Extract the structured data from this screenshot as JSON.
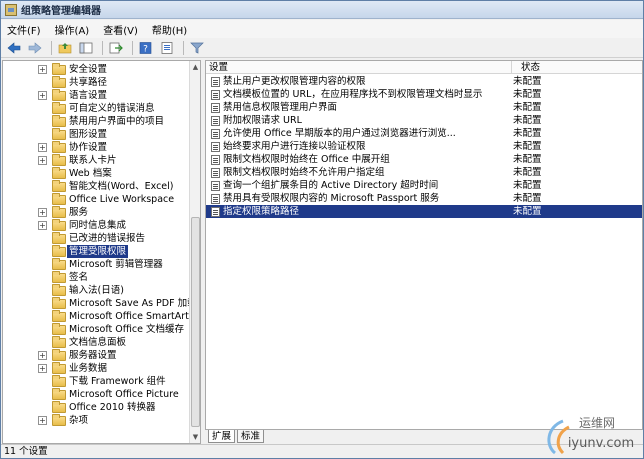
{
  "window": {
    "title": "组策略管理编辑器"
  },
  "menu": [
    "文件(F)",
    "操作(A)",
    "查看(V)",
    "帮助(H)"
  ],
  "toolbar": {
    "icons": [
      "back-arrow-icon",
      "forward-arrow-icon",
      "up-folder-icon",
      "show-hide-tree-icon",
      "export-list-icon",
      "help-icon",
      "properties-icon",
      "filter-icon"
    ]
  },
  "tree": [
    {
      "label": "安全设置",
      "expander": true
    },
    {
      "label": "共享路径",
      "expander": false
    },
    {
      "label": "语言设置",
      "expander": true
    },
    {
      "label": "可自定义的错误消息",
      "expander": false
    },
    {
      "label": "禁用用户界面中的项目",
      "expander": false
    },
    {
      "label": "图形设置",
      "expander": false
    },
    {
      "label": "协作设置",
      "expander": true
    },
    {
      "label": "联系人卡片",
      "expander": true
    },
    {
      "label": "Web 档案",
      "expander": false
    },
    {
      "label": "智能文档(Word、Excel)",
      "expander": false
    },
    {
      "label": "Office Live Workspace",
      "expander": false
    },
    {
      "label": "服务",
      "expander": true
    },
    {
      "label": "同时信息集成",
      "expander": true
    },
    {
      "label": "已改进的错误报告",
      "expander": false
    },
    {
      "label": "管理受限权限",
      "expander": false,
      "selected": true
    },
    {
      "label": "Microsoft 剪辑管理器",
      "expander": false
    },
    {
      "label": "签名",
      "expander": false
    },
    {
      "label": "输入法(日语)",
      "expander": false
    },
    {
      "label": "Microsoft Save As PDF 加载",
      "expander": false
    },
    {
      "label": "Microsoft Office SmartArt",
      "expander": false
    },
    {
      "label": "Microsoft Office 文档缓存",
      "expander": false
    },
    {
      "label": "文档信息面板",
      "expander": false
    },
    {
      "label": "服务器设置",
      "expander": true
    },
    {
      "label": "业务数据",
      "expander": true
    },
    {
      "label": "下载 Framework 组件",
      "expander": false
    },
    {
      "label": "Microsoft Office Picture",
      "expander": false
    },
    {
      "label": "Office 2010 转换器",
      "expander": false
    },
    {
      "label": "杂项",
      "expander": true
    }
  ],
  "list": {
    "columns": {
      "setting": "设置",
      "state": "状态"
    },
    "rows": [
      {
        "setting": "禁止用户更改权限管理内容的权限",
        "state": "未配置"
      },
      {
        "setting": "文档模板位置的 URL，在应用程序找不到权限管理文档时显示",
        "state": "未配置"
      },
      {
        "setting": "禁用信息权限管理用户界面",
        "state": "未配置"
      },
      {
        "setting": "附加权限请求 URL",
        "state": "未配置"
      },
      {
        "setting": "允许使用 Office 早期版本的用户通过浏览器进行浏览...",
        "state": "未配置"
      },
      {
        "setting": "始终要求用户进行连接以验证权限",
        "state": "未配置"
      },
      {
        "setting": "限制文档权限时始终在 Office 中展开组",
        "state": "未配置"
      },
      {
        "setting": "限制文档权限时始终不允许用户指定组",
        "state": "未配置"
      },
      {
        "setting": "查询一个组扩展条目的 Active Directory 超时时间",
        "state": "未配置"
      },
      {
        "setting": "禁用具有受限权限内容的 Microsoft Passport 服务",
        "state": "未配置"
      },
      {
        "setting": "指定权限策略路径",
        "state": "未配置",
        "selected": true
      }
    ]
  },
  "tabs": [
    "扩展",
    "标准"
  ],
  "status": {
    "text": "11 个设置"
  },
  "watermark": {
    "name": "运维网",
    "url": "iyunv.com"
  },
  "colors": {
    "selection": "#1f3a8a",
    "titlebar": "#c6d6ea",
    "folder": "#f0c85a"
  }
}
